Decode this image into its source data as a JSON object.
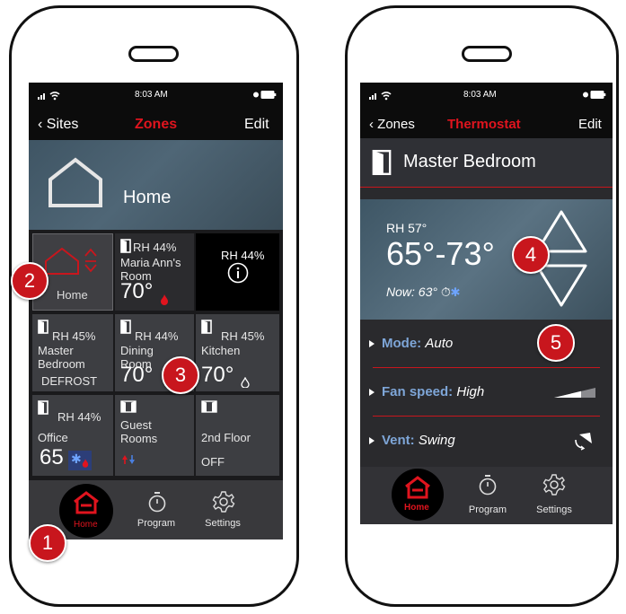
{
  "colors": {
    "accent": "#c8161d",
    "screen_bg": "#1a1a1c",
    "tile_bg": "#3d3e42",
    "label_blue": "#7ea6d8"
  },
  "left": {
    "status": {
      "time": "8:03 AM"
    },
    "nav": {
      "back": "Sites",
      "title": "Zones",
      "edit": "Edit"
    },
    "banner": {
      "label": "Home"
    },
    "tiles": [
      {
        "name": "Home"
      },
      {
        "rh": "RH 44%",
        "name1": "Maria Ann's",
        "name2": "Room",
        "temp": "70°"
      },
      {
        "rh": "RH 44%"
      },
      {
        "rh": "RH 45%",
        "name1": "Master",
        "name2": "Bedroom",
        "status": "DEFROST"
      },
      {
        "rh": "RH 44%",
        "name1": "Dining",
        "name2": "Room",
        "temp": "70°"
      },
      {
        "rh": "RH 45%",
        "name1": "Kitchen",
        "temp": "70°"
      },
      {
        "rh": "RH 44%",
        "name1": "Office",
        "temp": "65"
      },
      {
        "name1": "Guest",
        "name2": "Rooms"
      },
      {
        "name1": "2nd Floor",
        "status": "OFF"
      }
    ],
    "tabs": {
      "home": "Home",
      "program": "Program",
      "settings": "Settings"
    },
    "callouts": [
      "1",
      "2",
      "3"
    ]
  },
  "right": {
    "status": {
      "time": "8:03 AM"
    },
    "nav": {
      "back": "Zones",
      "title": "Thermostat",
      "edit": "Edit"
    },
    "room": {
      "name": "Master Bedroom"
    },
    "hero": {
      "rh": "RH 57°",
      "range": "65°-73°",
      "now": "Now: 63°"
    },
    "rows": {
      "mode_label": "Mode:",
      "mode_value": "Auto",
      "fan_label": "Fan speed:",
      "fan_value": "High",
      "vent_label": "Vent:",
      "vent_value": "Swing"
    },
    "tabs": {
      "home": "Home",
      "program": "Program",
      "settings": "Settings"
    },
    "callouts": [
      "4",
      "5"
    ]
  }
}
